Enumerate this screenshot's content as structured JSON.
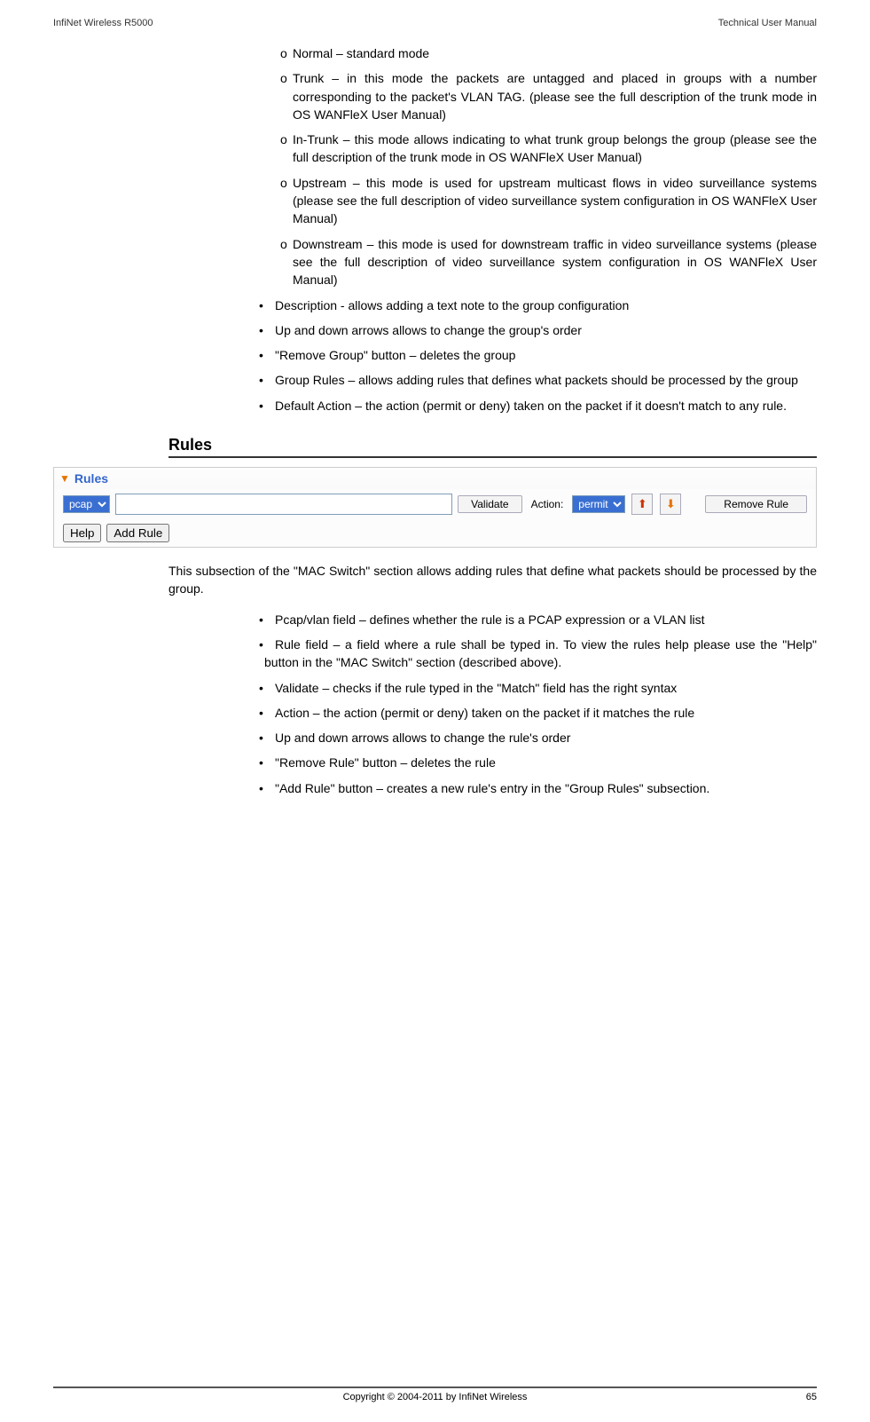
{
  "header": {
    "left": "InfiNet Wireless R5000",
    "right": "Technical User Manual"
  },
  "sublist": {
    "m0": "o",
    "i0": "Normal – standard mode",
    "m1": "o",
    "i1": "Trunk – in this mode the packets are untagged and placed in groups with a number corresponding to the packet's VLAN TAG. (please see the full description of the trunk mode in OS WANFleX User Manual)",
    "m2": "o",
    "i2": "In-Trunk – this mode allows indicating to what trunk group belongs the group (please see the full description of the trunk mode in OS WANFleX User Manual)",
    "m3": "o",
    "i3": "Upstream – this mode is used for upstream multicast flows in video surveillance systems (please see the full description of video surveillance system configuration in OS WANFleX User Manual)",
    "m4": "o",
    "i4": "Downstream – this mode is used for downstream traffic in video surveillance systems (please see the full description of video surveillance system configuration in OS WANFleX User Manual)"
  },
  "bullets1": {
    "b": "•",
    "i0": "Description - allows adding a text note to the group configuration",
    "i1": "Up and down arrows allows to change the group's order",
    "i2": "\"Remove Group\" button – deletes the group",
    "i3": "Group Rules – allows adding rules that defines what packets should be processed by the group",
    "i4": "Default Action – the action (permit or deny) taken on the packet if it doesn't match to any rule."
  },
  "section_title": "Rules",
  "toolbar": {
    "header_label": "Rules",
    "pcap_option": "pcap",
    "validate_label": "Validate",
    "action_label": "Action:",
    "permit_option": "permit",
    "remove_rule_label": "Remove Rule",
    "help_label": "Help",
    "add_rule_label": "Add Rule"
  },
  "para_after": "This subsection of the \"MAC Switch\" section allows adding rules that define what packets should be processed by the group.",
  "bullets2": {
    "b": "•",
    "i0": "Pcap/vlan field – defines whether the rule is a PCAP expression or a VLAN list",
    "i1": "Rule field – a field where a rule shall be typed in. To view the rules help please use the \"Help\" button in the \"MAC Switch\" section (described above).",
    "i2": "Validate – checks if the rule typed in the \"Match\" field has the right syntax",
    "i3": "Action – the action (permit or deny) taken on the packet if it matches the rule",
    "i4": "Up and down arrows allows to change the rule's order",
    "i5": "\"Remove Rule\" button – deletes the rule",
    "i6": "\"Add Rule\" button – creates a new rule's entry in the \"Group Rules\" subsection."
  },
  "footer": {
    "center": "Copyright © 2004-2011 by InfiNet Wireless",
    "page": "65"
  }
}
